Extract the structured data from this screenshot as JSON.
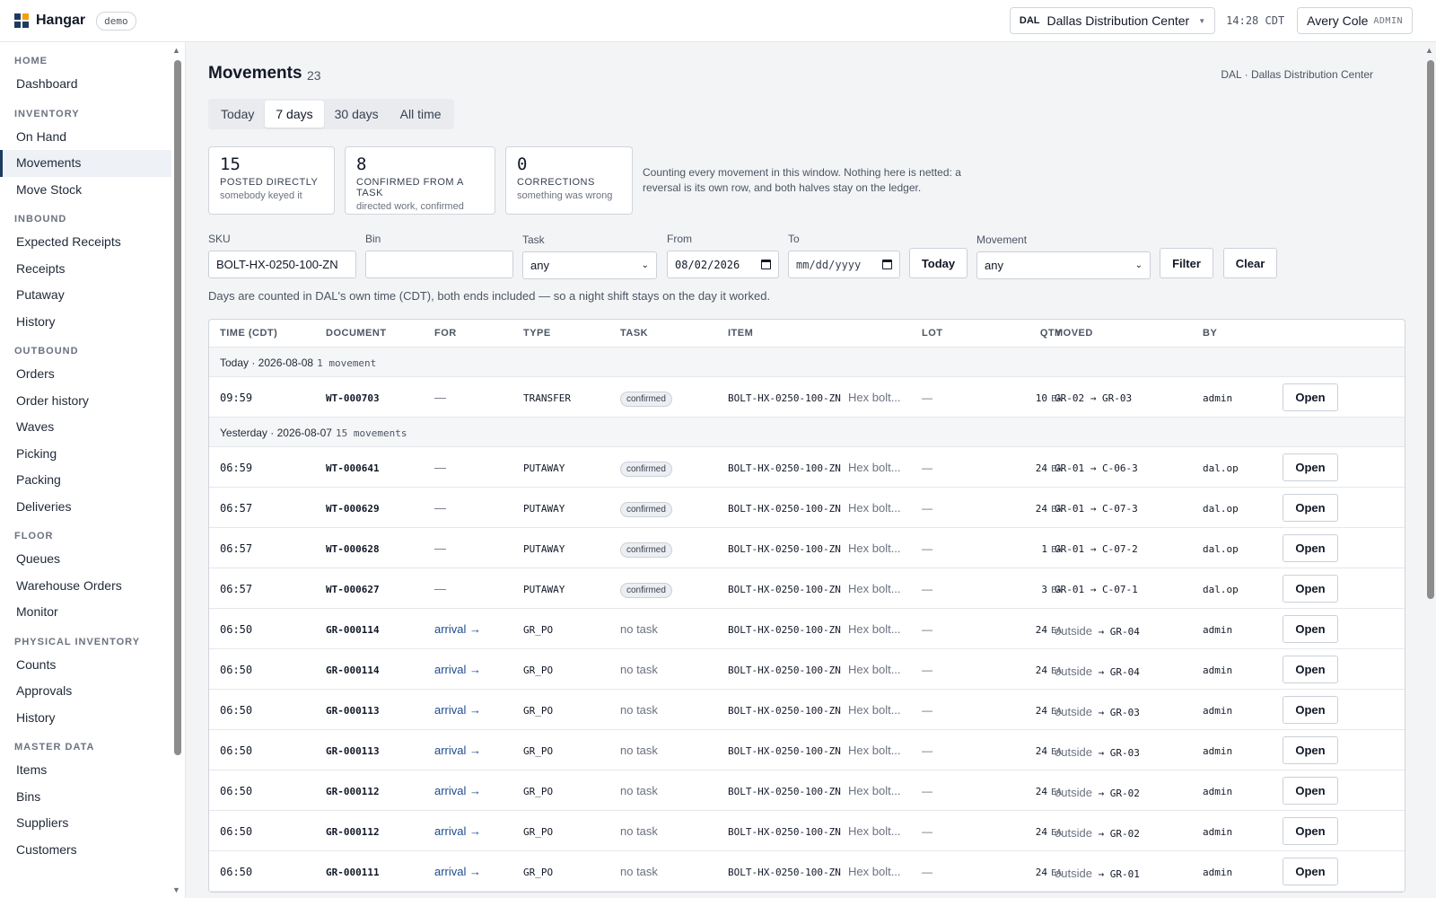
{
  "header": {
    "brand": "Hangar",
    "badge": "demo",
    "site_code": "DAL",
    "site_name": "Dallas Distribution Center",
    "clock": "14:28 CDT",
    "user_name": "Avery Cole",
    "user_role": "ADMIN",
    "logo_colors": [
      "#1e3a5f",
      "#f59e0b",
      "#1e3a5f",
      "#1e3a5f"
    ]
  },
  "sidebar": {
    "sections": [
      {
        "title": "HOME",
        "items": [
          "Dashboard"
        ]
      },
      {
        "title": "INVENTORY",
        "items": [
          "On Hand",
          "Movements",
          "Move Stock"
        ]
      },
      {
        "title": "INBOUND",
        "items": [
          "Expected Receipts",
          "Receipts",
          "Putaway",
          "History"
        ]
      },
      {
        "title": "OUTBOUND",
        "items": [
          "Orders",
          "Order history",
          "Waves",
          "Picking",
          "Packing",
          "Deliveries"
        ]
      },
      {
        "title": "FLOOR",
        "items": [
          "Queues",
          "Warehouse Orders",
          "Monitor"
        ]
      },
      {
        "title": "PHYSICAL INVENTORY",
        "items": [
          "Counts",
          "Approvals",
          "History"
        ]
      },
      {
        "title": "MASTER DATA",
        "items": [
          "Items",
          "Bins",
          "Suppliers",
          "Customers"
        ]
      }
    ],
    "active": "Movements"
  },
  "page": {
    "title": "Movements",
    "count": "23",
    "site_label": "DAL · Dallas Distribution Center",
    "tabs": [
      "Today",
      "7 days",
      "30 days",
      "All time"
    ],
    "active_tab": "7 days"
  },
  "stats": [
    {
      "value": "15",
      "label": "POSTED DIRECTLY",
      "sub": "somebody keyed it"
    },
    {
      "value": "8",
      "label": "CONFIRMED FROM A TASK",
      "sub": "directed work, confirmed"
    },
    {
      "value": "0",
      "label": "CORRECTIONS",
      "sub": "something was wrong"
    }
  ],
  "stats_note": "Counting every movement in this window. Nothing here is netted: a reversal is its own row, and both halves stay on the ledger.",
  "filters": {
    "sku_label": "SKU",
    "sku_value": "BOLT-HX-0250-100-ZN",
    "bin_label": "Bin",
    "bin_value": "",
    "task_label": "Task",
    "task_value": "any",
    "from_label": "From",
    "from_value": "08/02/2026",
    "to_label": "To",
    "to_placeholder": "mm/dd/yyyy",
    "today_button": "Today",
    "movement_label": "Movement",
    "movement_value": "any",
    "filter_button": "Filter",
    "clear_button": "Clear"
  },
  "hint": "Days are counted in DAL's own time (CDT), both ends included — so a night shift stays on the day it worked.",
  "table": {
    "columns": [
      "TIME (CDT)",
      "DOCUMENT",
      "FOR",
      "TYPE",
      "TASK",
      "ITEM",
      "LOT",
      "QTY",
      "MOVED",
      "BY"
    ],
    "open_label": "Open",
    "groups": [
      {
        "label": "Today · 2026-08-08",
        "count": "1 movement",
        "rows": [
          {
            "time": "09:59",
            "doc": "WT-000703",
            "for": "—",
            "type": "TRANSFER",
            "task": "confirmed",
            "item": "BOLT-HX-0250-100-ZN",
            "desc": "Hex bolt...",
            "lot": "—",
            "qty": "10",
            "uom": "EA",
            "from": "GR-02",
            "arrow": "→",
            "to": "GR-03",
            "by": "admin"
          }
        ]
      },
      {
        "label": "Yesterday · 2026-08-07",
        "count": "15 movements",
        "rows": [
          {
            "time": "06:59",
            "doc": "WT-000641",
            "for": "—",
            "type": "PUTAWAY",
            "task": "confirmed",
            "item": "BOLT-HX-0250-100-ZN",
            "desc": "Hex bolt...",
            "lot": "—",
            "qty": "24",
            "uom": "EA",
            "from": "GR-01",
            "arrow": "→",
            "to": "C-06-3",
            "by": "dal.op"
          },
          {
            "time": "06:57",
            "doc": "WT-000629",
            "for": "—",
            "type": "PUTAWAY",
            "task": "confirmed",
            "item": "BOLT-HX-0250-100-ZN",
            "desc": "Hex bolt...",
            "lot": "—",
            "qty": "24",
            "uom": "EA",
            "from": "GR-01",
            "arrow": "→",
            "to": "C-07-3",
            "by": "dal.op"
          },
          {
            "time": "06:57",
            "doc": "WT-000628",
            "for": "—",
            "type": "PUTAWAY",
            "task": "confirmed",
            "item": "BOLT-HX-0250-100-ZN",
            "desc": "Hex bolt...",
            "lot": "—",
            "qty": "1",
            "uom": "EA",
            "from": "GR-01",
            "arrow": "→",
            "to": "C-07-2",
            "by": "dal.op"
          },
          {
            "time": "06:57",
            "doc": "WT-000627",
            "for": "—",
            "type": "PUTAWAY",
            "task": "confirmed",
            "item": "BOLT-HX-0250-100-ZN",
            "desc": "Hex bolt...",
            "lot": "—",
            "qty": "3",
            "uom": "EA",
            "from": "GR-01",
            "arrow": "→",
            "to": "C-07-1",
            "by": "dal.op"
          },
          {
            "time": "06:50",
            "doc": "GR-000114",
            "for": "arrival →",
            "type": "GR_PO",
            "task": "no task",
            "item": "BOLT-HX-0250-100-ZN",
            "desc": "Hex bolt...",
            "lot": "—",
            "qty": "24",
            "uom": "EA",
            "from": "outside",
            "arrow": "→",
            "to": "GR-04",
            "by": "admin"
          },
          {
            "time": "06:50",
            "doc": "GR-000114",
            "for": "arrival →",
            "type": "GR_PO",
            "task": "no task",
            "item": "BOLT-HX-0250-100-ZN",
            "desc": "Hex bolt...",
            "lot": "—",
            "qty": "24",
            "uom": "EA",
            "from": "outside",
            "arrow": "→",
            "to": "GR-04",
            "by": "admin"
          },
          {
            "time": "06:50",
            "doc": "GR-000113",
            "for": "arrival →",
            "type": "GR_PO",
            "task": "no task",
            "item": "BOLT-HX-0250-100-ZN",
            "desc": "Hex bolt...",
            "lot": "—",
            "qty": "24",
            "uom": "EA",
            "from": "outside",
            "arrow": "→",
            "to": "GR-03",
            "by": "admin"
          },
          {
            "time": "06:50",
            "doc": "GR-000113",
            "for": "arrival →",
            "type": "GR_PO",
            "task": "no task",
            "item": "BOLT-HX-0250-100-ZN",
            "desc": "Hex bolt...",
            "lot": "—",
            "qty": "24",
            "uom": "EA",
            "from": "outside",
            "arrow": "→",
            "to": "GR-03",
            "by": "admin"
          },
          {
            "time": "06:50",
            "doc": "GR-000112",
            "for": "arrival →",
            "type": "GR_PO",
            "task": "no task",
            "item": "BOLT-HX-0250-100-ZN",
            "desc": "Hex bolt...",
            "lot": "—",
            "qty": "24",
            "uom": "EA",
            "from": "outside",
            "arrow": "→",
            "to": "GR-02",
            "by": "admin"
          },
          {
            "time": "06:50",
            "doc": "GR-000112",
            "for": "arrival →",
            "type": "GR_PO",
            "task": "no task",
            "item": "BOLT-HX-0250-100-ZN",
            "desc": "Hex bolt...",
            "lot": "—",
            "qty": "24",
            "uom": "EA",
            "from": "outside",
            "arrow": "→",
            "to": "GR-02",
            "by": "admin"
          },
          {
            "time": "06:50",
            "doc": "GR-000111",
            "for": "arrival →",
            "type": "GR_PO",
            "task": "no task",
            "item": "BOLT-HX-0250-100-ZN",
            "desc": "Hex bolt...",
            "lot": "—",
            "qty": "24",
            "uom": "EA",
            "from": "outside",
            "arrow": "→",
            "to": "GR-01",
            "by": "admin"
          }
        ]
      }
    ]
  }
}
